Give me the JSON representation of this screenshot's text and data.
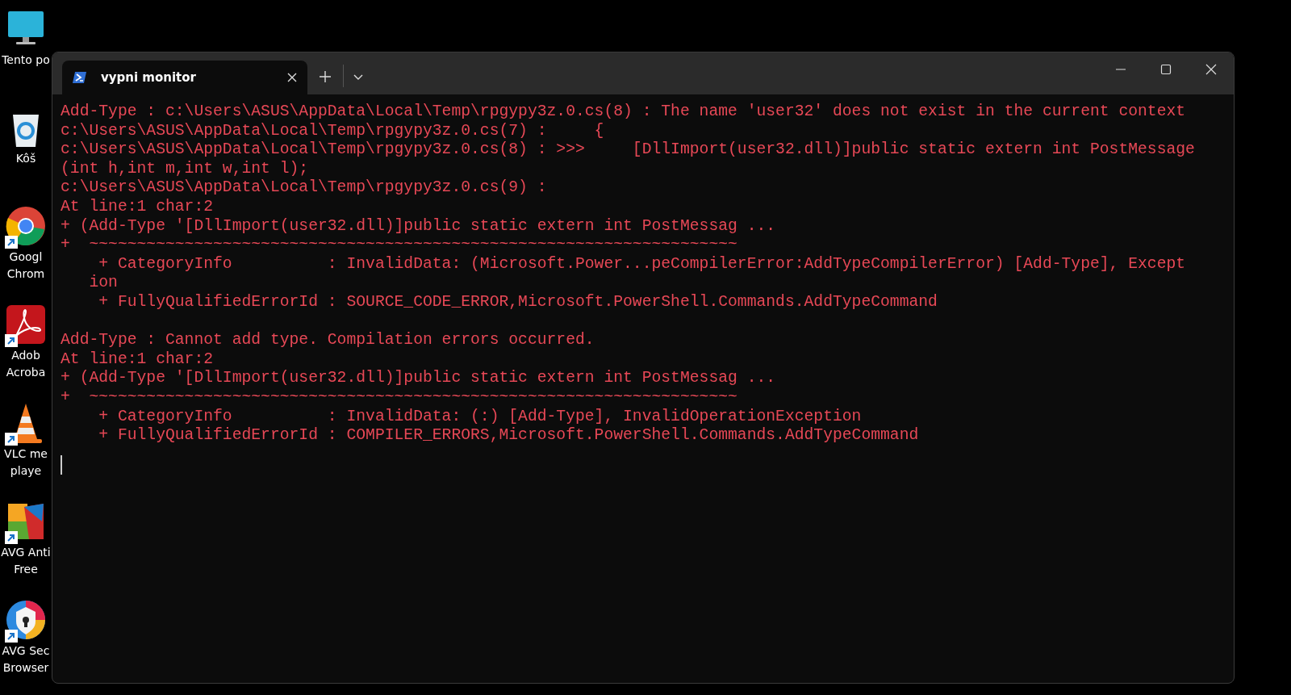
{
  "desktop": {
    "icons": [
      {
        "kind": "monitor",
        "shortcut": false,
        "label_lines": [
          "Tento po"
        ]
      },
      {
        "kind": "recycle-bin",
        "shortcut": false,
        "label_lines": [
          "Kôš"
        ]
      },
      {
        "kind": "browser",
        "shortcut": true,
        "label_lines": [
          "Googl",
          "Chrom"
        ]
      },
      {
        "kind": "pdf",
        "shortcut": true,
        "label_lines": [
          "Adob",
          "Acroba"
        ]
      },
      {
        "kind": "cone",
        "shortcut": true,
        "label_lines": [
          "VLC me",
          "playe"
        ]
      },
      {
        "kind": "antivirus",
        "shortcut": true,
        "label_lines": [
          "AVG Anti",
          "Free"
        ]
      },
      {
        "kind": "secure-browser",
        "shortcut": true,
        "label_lines": [
          "AVG Sec",
          "Browser"
        ]
      }
    ]
  },
  "window": {
    "tabs": [
      {
        "title": "vypni monitor",
        "selected": true
      }
    ],
    "output_blocks": [
      [
        "Add-Type : c:\\Users\\ASUS\\AppData\\Local\\Temp\\rpgypy3z.0.cs(8) : The name 'user32' does not exist in the current context",
        "c:\\Users\\ASUS\\AppData\\Local\\Temp\\rpgypy3z.0.cs(7) :     {",
        "c:\\Users\\ASUS\\AppData\\Local\\Temp\\rpgypy3z.0.cs(8) : >>>     [DllImport(user32.dll)]public static extern int PostMessage",
        "(int h,int m,int w,int l);",
        "c:\\Users\\ASUS\\AppData\\Local\\Temp\\rpgypy3z.0.cs(9) :",
        "At line:1 char:2",
        "+ (Add-Type '[DllImport(user32.dll)]public static extern int PostMessag ...",
        "+  ~~~~~~~~~~~~~~~~~~~~~~~~~~~~~~~~~~~~~~~~~~~~~~~~~~~~~~~~~~~~~~~~~~~~",
        "    + CategoryInfo          : InvalidData: (Microsoft.Power...peCompilerError:AddTypeCompilerError) [Add-Type], Except",
        "   ion",
        "    + FullyQualifiedErrorId : SOURCE_CODE_ERROR,Microsoft.PowerShell.Commands.AddTypeCommand"
      ],
      [
        "Add-Type : Cannot add type. Compilation errors occurred.",
        "At line:1 char:2",
        "+ (Add-Type '[DllImport(user32.dll)]public static extern int PostMessag ...",
        "+  ~~~~~~~~~~~~~~~~~~~~~~~~~~~~~~~~~~~~~~~~~~~~~~~~~~~~~~~~~~~~~~~~~~~~",
        "    + CategoryInfo          : InvalidData: (:) [Add-Type], InvalidOperationException",
        "    + FullyQualifiedErrorId : COMPILER_ERRORS,Microsoft.PowerShell.Commands.AddTypeCommand"
      ]
    ]
  }
}
